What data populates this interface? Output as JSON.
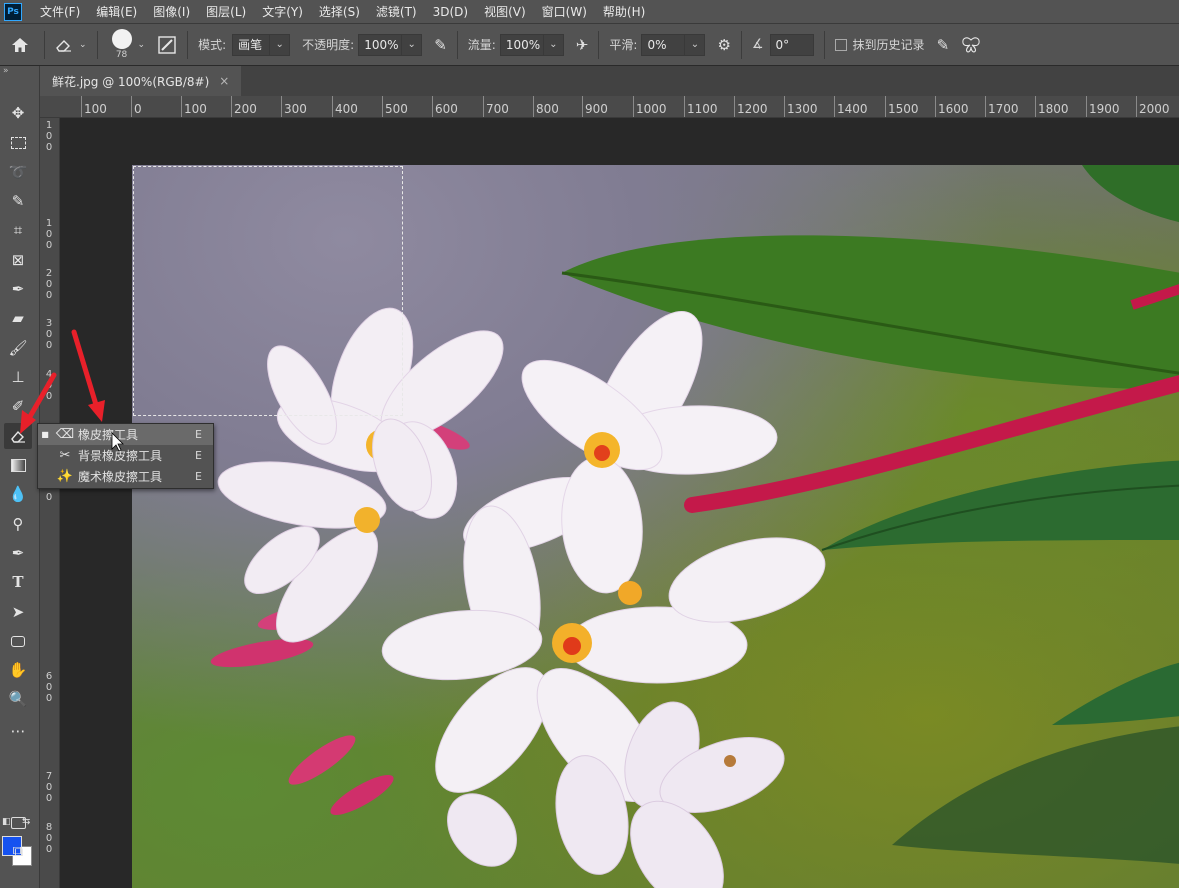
{
  "app": {
    "logo": "Ps"
  },
  "menu": [
    "文件(F)",
    "编辑(E)",
    "图像(I)",
    "图层(L)",
    "文字(Y)",
    "选择(S)",
    "滤镜(T)",
    "3D(D)",
    "视图(V)",
    "窗口(W)",
    "帮助(H)"
  ],
  "options": {
    "brush_size": "78",
    "mode_label": "模式:",
    "mode_value": "画笔",
    "opacity_label": "不透明度:",
    "opacity_value": "100%",
    "flow_label": "流量:",
    "flow_value": "100%",
    "smooth_label": "平滑:",
    "smooth_value": "0%",
    "angle_value": "0°",
    "history_label": "抹到历史记录"
  },
  "tab": {
    "title": "鲜花.jpg @ 100%(RGB/8#)",
    "close": "×"
  },
  "ruler_top": [
    "100",
    "0",
    "100",
    "200",
    "300",
    "400",
    "500",
    "600",
    "700",
    "800",
    "900",
    "1000",
    "1100",
    "1200",
    "1300",
    "1400",
    "1500",
    "1600",
    "1700",
    "1800",
    "1900",
    "2000"
  ],
  "ruler_left": [
    "1",
    "0",
    "0",
    "1",
    "0",
    "0",
    "2",
    "0",
    "0",
    "3",
    "0",
    "0",
    "4",
    "0",
    "0",
    "5",
    "0",
    "0",
    "6",
    "0",
    "0",
    "7",
    "0",
    "0",
    "8",
    "0",
    "0"
  ],
  "flyout": {
    "items": [
      {
        "label": "橡皮擦工具",
        "key": "E",
        "icon": "eraser-icon"
      },
      {
        "label": "背景橡皮擦工具",
        "key": "E",
        "icon": "background-eraser-icon"
      },
      {
        "label": "魔术橡皮擦工具",
        "key": "E",
        "icon": "magic-eraser-icon"
      }
    ]
  },
  "colors": {
    "foreground": "#1552f0",
    "background": "#ffffff",
    "arrow": "#e8202a"
  }
}
